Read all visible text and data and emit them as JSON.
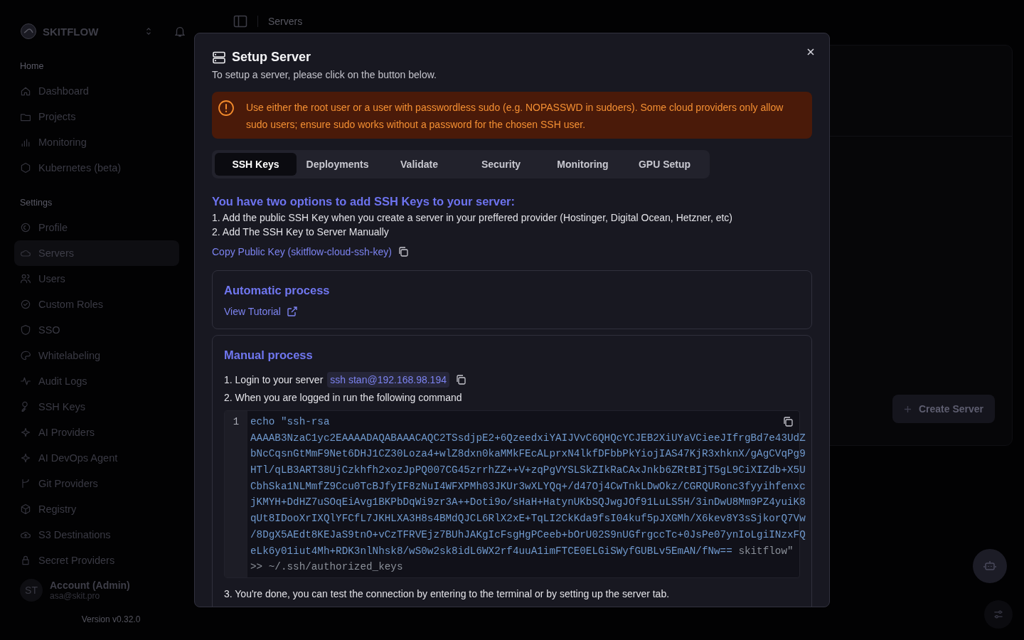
{
  "sidebar": {
    "brand": "SKITFLOW",
    "sections": [
      {
        "label": "Home",
        "items": [
          {
            "label": "Dashboard",
            "selected": false
          },
          {
            "label": "Projects",
            "selected": false
          },
          {
            "label": "Monitoring",
            "selected": false
          },
          {
            "label": "Kubernetes (beta)",
            "selected": false
          }
        ]
      },
      {
        "label": "Settings",
        "items": [
          {
            "label": "Profile",
            "selected": false
          },
          {
            "label": "Servers",
            "selected": true
          },
          {
            "label": "Users",
            "selected": false
          },
          {
            "label": "Custom Roles",
            "selected": false
          },
          {
            "label": "SSO",
            "selected": false
          },
          {
            "label": "Whitelabeling",
            "selected": false
          },
          {
            "label": "Audit Logs",
            "selected": false
          },
          {
            "label": "SSH Keys",
            "selected": false
          },
          {
            "label": "AI Providers",
            "selected": false
          },
          {
            "label": "AI DevOps Agent",
            "selected": false
          },
          {
            "label": "Git Providers",
            "selected": false
          },
          {
            "label": "Registry",
            "selected": false
          },
          {
            "label": "S3 Destinations",
            "selected": false
          },
          {
            "label": "Secret Providers",
            "selected": false
          }
        ]
      }
    ],
    "account": {
      "initials": "ST",
      "name": "Account (Admin)",
      "email": "asa@skit.pro"
    },
    "version": "Version v0.32.0"
  },
  "topbar": {
    "breadcrumb": "Servers"
  },
  "main": {
    "create_button": "Create Server"
  },
  "dialog": {
    "title": "Setup Server",
    "subtitle": "To setup a server, please click on the button below.",
    "alert": "Use either the root user or a user with passwordless sudo (e.g. NOPASSWD in sudoers). Some cloud providers only allow sudo users; ensure sudo works without a password for the chosen SSH user.",
    "tabs": [
      {
        "label": "SSH Keys",
        "selected": true
      },
      {
        "label": "Deployments",
        "selected": false
      },
      {
        "label": "Validate",
        "selected": false
      },
      {
        "label": "Security",
        "selected": false
      },
      {
        "label": "Monitoring",
        "selected": false
      },
      {
        "label": "GPU Setup",
        "selected": false
      }
    ],
    "heading": "You have two options to add SSH Keys to your server:",
    "options": [
      "1. Add the public SSH Key when you create a server in your preffered provider (Hostinger, Digital Ocean, Hetzner, etc)",
      "2. Add The SSH Key to Server Manually"
    ],
    "copy_link": "Copy Public Key (skitflow-cloud-ssh-key)",
    "automatic": {
      "title": "Automatic process",
      "link": "View Tutorial"
    },
    "manual": {
      "title": "Manual process",
      "login_text": "1. Login to your server",
      "command": "ssh stan@192.168.98.194",
      "run_text": "2. When you are logged in run the following command",
      "code": {
        "line_number": "1",
        "lines": [
          [
            {
              "text": "echo \"ssh-rsa",
              "kind": "string"
            }
          ],
          [
            {
              "text": "AAAAB3NzaC1yc2EAAAADAQABAAACAQC2TSsdjpE2+6QzeedxiYAIJVvC6QHQcYCJEB2XiUYaVCieeJIfrgBd7e43UdZ",
              "kind": "string"
            }
          ],
          [
            {
              "text": "bNcCqsnGtMmF9Net6DHJ1CZ30Loza4+wlZ8dxn0kaMMkFEcALprxN4lkfDFbbPkYiojIAS47KjR3xhknX/gAgCVqPg9",
              "kind": "string"
            }
          ],
          [
            {
              "text": "HTl/qLB3ART38UjCzkhfh2xozJpPQ007CG45zrrhZZ++V+zqPgVYSLSkZIkRaCAxJnkb6ZRtBIjT5gL9CiXIZdb+X5U",
              "kind": "string"
            }
          ],
          [
            {
              "text": "CbhSka1NLMmfZ9Ccu0TcBJfyIF8zNuI4WFXPMh03JKUr3wXLYQq+/d47Oj4CwTnkLDwOkz/CGRQURonc3fyyihfenxc",
              "kind": "string"
            }
          ],
          [
            {
              "text": "jKMYH+DdHZ7uSOqEiAvg1BKPbDqWi9zr3A++Doti9o/sHaH+HatynUKbSQJwgJOf91LuLS5H/3inDwU8Mm9PZ4yuiK8",
              "kind": "string"
            }
          ],
          [
            {
              "text": "qUt8IDooXrIXQlYFCfL7JKHLXA3H8s4BMdQJCL6RlX2xE+TqLI2CkKda9fsI04kuf5pJXGMh/X6kev8Y3sSjkorQ7Vw",
              "kind": "string"
            }
          ],
          [
            {
              "text": "/8DgX5AEdt8KEJaS9tnO+vCzTFRVEjz7BUhJAKgIcFsgHgPCeeb+bOrU02S9nUGfrgccTc+0JsPe07ynIoLgiINzxFQ",
              "kind": "string"
            }
          ],
          [
            {
              "text": "eLk6y01iut4Mh+RDK3nlNhsk8/wS0w2sk8idL6WX2rf4uuA1imFTCE0ELGiSWyfGUBLv5EmAN/fNw==",
              "kind": "string"
            },
            {
              "text": " skitflow\"",
              "kind": "plain"
            }
          ],
          [
            {
              "text": ">> ~/.ssh/authorized_keys",
              "kind": "plain"
            }
          ]
        ]
      },
      "done_text": "3. You're done, you can test the connection by entering to the terminal or by setting up the server tab."
    }
  }
}
